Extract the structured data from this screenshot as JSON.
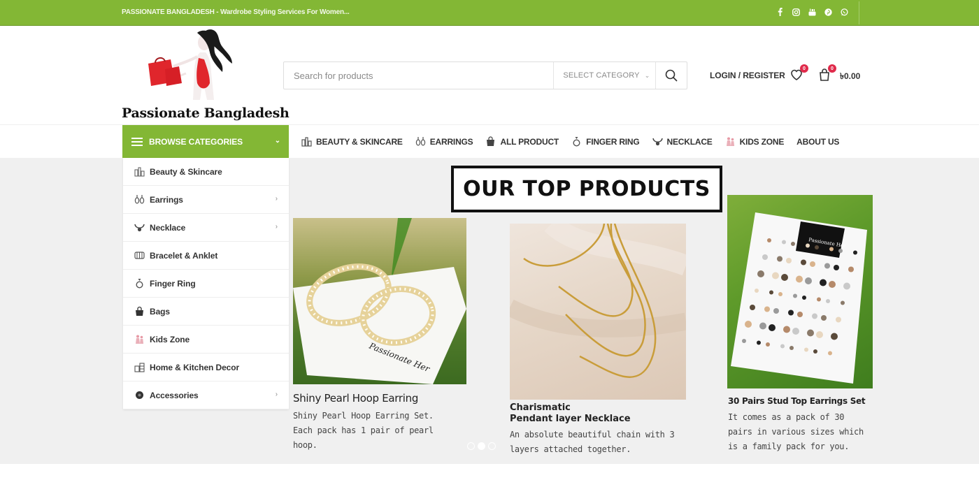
{
  "topbar": {
    "promo": "PASSIONATE BANGLADESH - Wardrobe Styling Services For Women...",
    "social_icons": [
      "facebook-icon",
      "instagram-icon",
      "youtube-icon",
      "pinterest-icon",
      "whatsapp-icon"
    ]
  },
  "header": {
    "logo_text": "Passionate Bangladesh",
    "search": {
      "placeholder": "Search for products",
      "category_label": "SELECT CATEGORY"
    },
    "login_label": "LOGIN / REGISTER",
    "wishlist_count": "0",
    "cart_count": "0",
    "cart_total": "৳0.00"
  },
  "nav": {
    "browse_label": "BROWSE CATEGORIES",
    "items": [
      {
        "label": "BEAUTY & SKINCARE",
        "icon": "cosmetics-icon"
      },
      {
        "label": "EARRINGS",
        "icon": "earrings-icon"
      },
      {
        "label": "ALL PRODUCT",
        "icon": "shopping-bag-icon"
      },
      {
        "label": "FINGER RING",
        "icon": "ring-icon"
      },
      {
        "label": "NECKLACE",
        "icon": "necklace-icon"
      },
      {
        "label": "KIDS ZONE",
        "icon": "kids-icon"
      },
      {
        "label": "ABOUT US",
        "icon": ""
      }
    ]
  },
  "categories": [
    {
      "label": "Beauty & Skincare",
      "icon": "cosmetics-icon",
      "has_sub": false
    },
    {
      "label": "Earrings",
      "icon": "earrings-icon",
      "has_sub": true
    },
    {
      "label": "Necklace",
      "icon": "necklace-icon",
      "has_sub": true
    },
    {
      "label": "Bracelet & Anklet",
      "icon": "bracelet-icon",
      "has_sub": false
    },
    {
      "label": "Finger Ring",
      "icon": "ring-icon",
      "has_sub": false
    },
    {
      "label": "Bags",
      "icon": "bag-icon",
      "has_sub": false
    },
    {
      "label": "Kids Zone",
      "icon": "kids-icon",
      "has_sub": false
    },
    {
      "label": "Home & Kitchen Decor",
      "icon": "home-decor-icon",
      "has_sub": false
    },
    {
      "label": "Accessories",
      "icon": "accessories-icon",
      "has_sub": true
    }
  ],
  "showcase": {
    "heading": "OUR TOP PRODUCTS",
    "products": [
      {
        "title": "Shiny Pearl Hoop Earring",
        "desc_lines": [
          "Shiny Pearl Hoop Earring Set.",
          "Each pack has 1 pair of pearl",
          "hoop."
        ],
        "card_text": "Passionate Her"
      },
      {
        "title_lines": [
          "Charismatic",
          "Pendant layer Necklace"
        ],
        "desc_lines": [
          "An absolute beautiful chain with 3",
          "layers attached together."
        ]
      },
      {
        "title": "30 Pairs Stud Top Earrings Set",
        "desc_lines": [
          "It comes as a pack of 30",
          "pairs in various sizes which",
          "is a family pack for you."
        ],
        "card_text": "Passionate Her"
      }
    ],
    "slide_count": 3,
    "active_slide": 2
  },
  "colors": {
    "brand_green": "#83b735",
    "badge_red": "#e02b4b"
  }
}
